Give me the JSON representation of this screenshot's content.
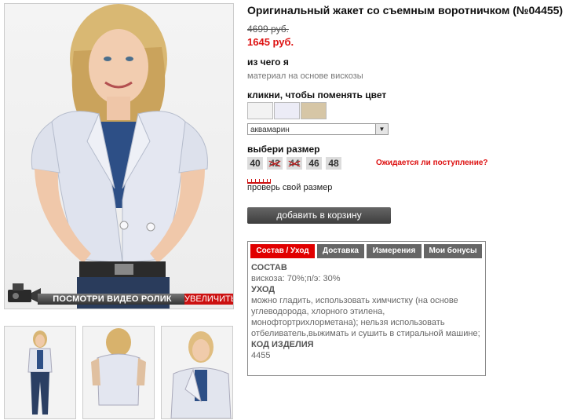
{
  "product": {
    "title": "Оригинальный жакет со съемным воротничком (№04455)",
    "old_price": "4699 руб.",
    "new_price": "1645 руб."
  },
  "material": {
    "heading": "из чего я",
    "text": "материал на основе вискозы"
  },
  "color": {
    "heading": "кликни, чтобы поменять цвет",
    "swatches": [
      "#f2f2f2",
      "#ececf6",
      "#d6c6a6"
    ],
    "selected": "аквамарин"
  },
  "size": {
    "heading": "выбери размер",
    "options": [
      {
        "label": "40",
        "available": true
      },
      {
        "label": "42",
        "available": false
      },
      {
        "label": "44",
        "available": false
      },
      {
        "label": "46",
        "available": true
      },
      {
        "label": "48",
        "available": true
      }
    ],
    "notify_link": "Ожидается ли поступление?",
    "check_link": "проверь свой размер"
  },
  "cart": {
    "button_label": "добавить в корзину"
  },
  "media": {
    "video_label": "ПОСМОТРИ ВИДЕО РОЛИК",
    "zoom_label": "УВЕЛИЧИТЬ"
  },
  "tabs": {
    "items": [
      "Состав / Уход",
      "Доставка",
      "Измерения",
      "Мои бонусы"
    ],
    "active": 0,
    "content": {
      "composition_heading": "СОСТАВ",
      "composition_text": "вискоза: 70%;п/э: 30%",
      "care_heading": "УХОД",
      "care_text": "можно гладить, использовать химчистку (на основе углеводорода, хлорного этилена, монофтортрихлорметана); нельзя использовать отбеливатель,выжимать и сушить в стиральной машине;",
      "code_heading": "КОД ИЗДЕЛИЯ",
      "code_value": "4455"
    }
  },
  "colors": {
    "accent": "#dd1111",
    "tab_active": "#e10000",
    "tab_inactive": "#666666"
  }
}
